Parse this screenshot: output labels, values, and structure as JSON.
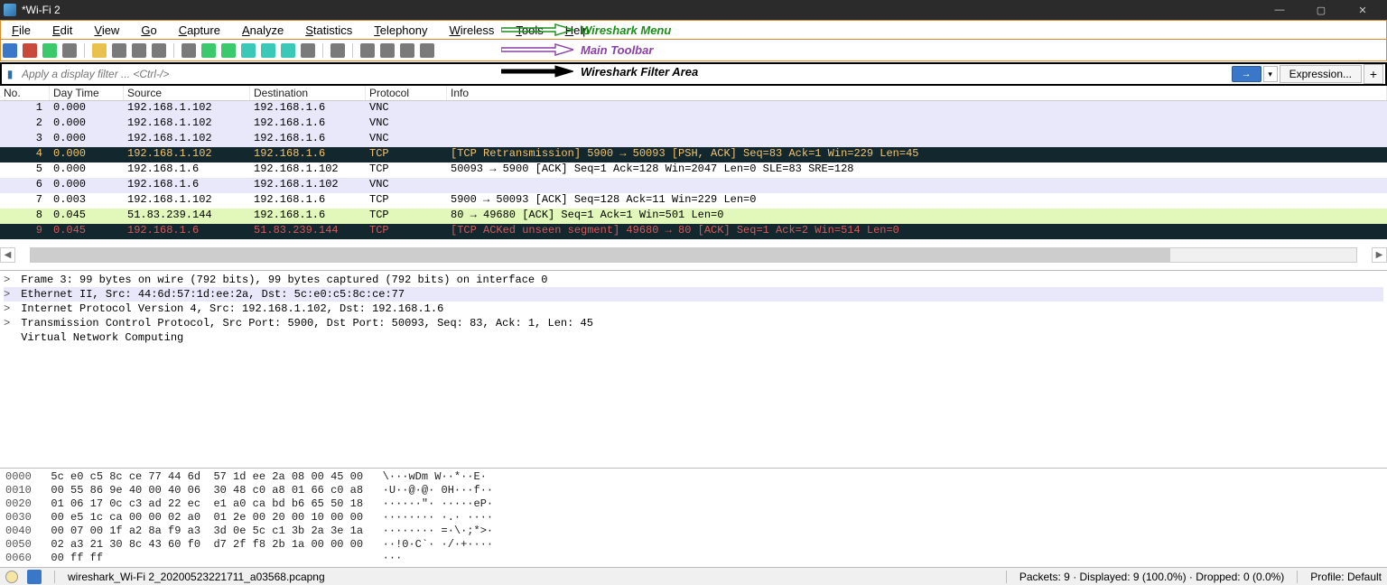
{
  "window": {
    "title": "*Wi-Fi 2"
  },
  "menu": {
    "items": [
      "File",
      "Edit",
      "View",
      "Go",
      "Capture",
      "Analyze",
      "Statistics",
      "Telephony",
      "Wireless",
      "Tools",
      "Help"
    ]
  },
  "annotations": {
    "menu": "Wireshark Menu",
    "toolbar": "Main Toolbar",
    "filter": "Wireshark Filter Area"
  },
  "filter": {
    "placeholder": "Apply a display filter ... <Ctrl-/>",
    "expr_btn": "Expression...",
    "plus": "+"
  },
  "columns": {
    "no": "No.",
    "time": "Day Time",
    "source": "Source",
    "dest": "Destination",
    "proto": "Protocol",
    "info": "Info"
  },
  "packets": [
    {
      "no": "1",
      "time": "0.000",
      "src": "192.168.1.102",
      "dst": "192.168.1.6",
      "proto": "VNC",
      "info": "",
      "cls": "row-lavender"
    },
    {
      "no": "2",
      "time": "0.000",
      "src": "192.168.1.102",
      "dst": "192.168.1.6",
      "proto": "VNC",
      "info": "",
      "cls": "row-lavender"
    },
    {
      "no": "3",
      "time": "0.000",
      "src": "192.168.1.102",
      "dst": "192.168.1.6",
      "proto": "VNC",
      "info": "",
      "cls": "row-lavender"
    },
    {
      "no": "4",
      "time": "0.000",
      "src": "192.168.1.102",
      "dst": "192.168.1.6",
      "proto": "TCP",
      "info": "[TCP Retransmission] 5900 → 50093 [PSH, ACK] Seq=83 Ack=1 Win=229 Len=45",
      "cls": "row-darkred"
    },
    {
      "no": "5",
      "time": "0.000",
      "src": "192.168.1.6",
      "dst": "192.168.1.102",
      "proto": "TCP",
      "info": "50093 → 5900 [ACK] Seq=1 Ack=128 Win=2047 Len=0 SLE=83 SRE=128",
      "cls": "row-white"
    },
    {
      "no": "6",
      "time": "0.000",
      "src": "192.168.1.6",
      "dst": "192.168.1.102",
      "proto": "VNC",
      "info": "",
      "cls": "row-lavender"
    },
    {
      "no": "7",
      "time": "0.003",
      "src": "192.168.1.102",
      "dst": "192.168.1.6",
      "proto": "TCP",
      "info": "5900 → 50093 [ACK] Seq=128 Ack=11 Win=229 Len=0",
      "cls": "row-white"
    },
    {
      "no": "8",
      "time": "0.045",
      "src": "51.83.239.144",
      "dst": "192.168.1.6",
      "proto": "TCP",
      "info": "80 → 49680 [ACK] Seq=1 Ack=1 Win=501 Len=0",
      "cls": "row-yellow"
    },
    {
      "no": "9",
      "time": "0.045",
      "src": "192.168.1.6",
      "dst": "51.83.239.144",
      "proto": "TCP",
      "info": "[TCP ACKed unseen segment] 49680 → 80 [ACK] Seq=1 Ack=2 Win=514 Len=0",
      "cls": "row-darkred2"
    }
  ],
  "details": [
    {
      "txt": "Frame 3: 99 bytes on wire (792 bits), 99 bytes captured (792 bits) on interface 0",
      "caret": true,
      "sel": false
    },
    {
      "txt": "Ethernet II, Src: 44:6d:57:1d:ee:2a, Dst: 5c:e0:c5:8c:ce:77",
      "caret": true,
      "sel": true
    },
    {
      "txt": "Internet Protocol Version 4, Src: 192.168.1.102, Dst: 192.168.1.6",
      "caret": true,
      "sel": false
    },
    {
      "txt": "Transmission Control Protocol, Src Port: 5900, Dst Port: 50093, Seq: 83, Ack: 1, Len: 45",
      "caret": true,
      "sel": false
    },
    {
      "txt": "Virtual Network Computing",
      "caret": false,
      "sel": false
    }
  ],
  "hex": [
    {
      "off": "0000",
      "b": "5c e0 c5 8c ce 77 44 6d  57 1d ee 2a 08 00 45 00",
      "a": "\\···wDm W··*··E·"
    },
    {
      "off": "0010",
      "b": "00 55 86 9e 40 00 40 06  30 48 c0 a8 01 66 c0 a8",
      "a": "·U··@·@· 0H···f··"
    },
    {
      "off": "0020",
      "b": "01 06 17 0c c3 ad 22 ec  e1 a0 ca bd b6 65 50 18",
      "a": "······\"· ·····eP·"
    },
    {
      "off": "0030",
      "b": "00 e5 1c ca 00 00 02 a0  01 2e 00 20 00 10 00 00",
      "a": "········ ·.· ····"
    },
    {
      "off": "0040",
      "b": "00 07 00 1f a2 8a f9 a3  3d 0e 5c c1 3b 2a 3e 1a",
      "a": "········ =·\\·;*>·"
    },
    {
      "off": "0050",
      "b": "02 a3 21 30 8c 43 60 f0  d7 2f f8 2b 1a 00 00 00",
      "a": "··!0·C`· ·/·+····"
    },
    {
      "off": "0060",
      "b": "00 ff ff",
      "a": "···"
    }
  ],
  "status": {
    "file": "wireshark_Wi-Fi 2_20200523221711_a03568.pcapng",
    "packets": "Packets: 9 · Displayed: 9 (100.0%) · Dropped: 0 (0.0%)",
    "profile": "Profile: Default"
  }
}
